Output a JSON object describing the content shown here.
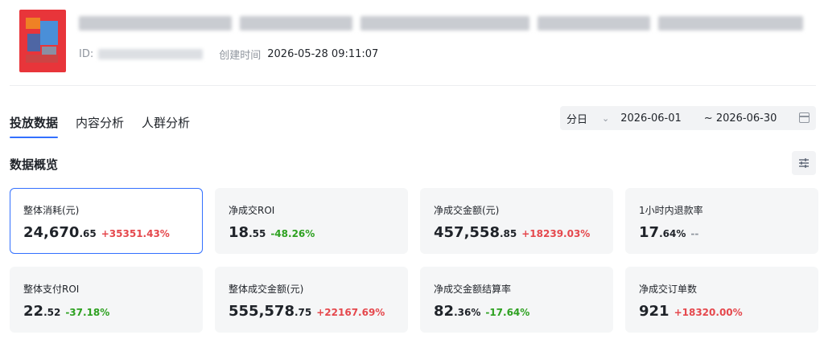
{
  "header": {
    "id_label": "ID:",
    "created_label": "创建时间",
    "created_value": "2026-05-28 09:11:07"
  },
  "tabs": [
    {
      "label": "投放数据",
      "active": true
    },
    {
      "label": "内容分析",
      "active": false
    },
    {
      "label": "人群分析",
      "active": false
    }
  ],
  "date_filter": {
    "granularity": "分日",
    "start": "2026-06-01",
    "end": "~ 2026-06-30"
  },
  "section": {
    "title": "数据概览"
  },
  "metrics": [
    {
      "label": "整体消耗(元)",
      "int": "24,670",
      "dec": ".65",
      "change": "+35351.43%",
      "trend": "up",
      "selected": true
    },
    {
      "label": "净成交ROI",
      "int": "18",
      "dec": ".55",
      "change": "-48.26%",
      "trend": "down",
      "selected": false
    },
    {
      "label": "净成交金额(元)",
      "int": "457,558",
      "dec": ".85",
      "change": "+18239.03%",
      "trend": "up",
      "selected": false
    },
    {
      "label": "1小时内退款率",
      "int": "17",
      "dec": ".64%",
      "change": "--",
      "trend": "none",
      "selected": false
    },
    {
      "label": "整体支付ROI",
      "int": "22",
      "dec": ".52",
      "change": "-37.18%",
      "trend": "down",
      "selected": false
    },
    {
      "label": "整体成交金额(元)",
      "int": "555,578",
      "dec": ".75",
      "change": "+22167.69%",
      "trend": "up",
      "selected": false
    },
    {
      "label": "净成交金额结算率",
      "int": "82",
      "dec": ".36%",
      "change": "-17.64%",
      "trend": "down",
      "selected": false
    },
    {
      "label": "净成交订单数",
      "int": "921",
      "dec": "",
      "change": "+18320.00%",
      "trend": "up",
      "selected": false
    }
  ],
  "colors": {
    "accent": "#3370ff",
    "up": "#e5484d",
    "down": "#2ea121",
    "muted": "#8f959e"
  },
  "icons": [
    "calendar-icon",
    "chevron-down-icon",
    "settings-sliders-icon"
  ]
}
